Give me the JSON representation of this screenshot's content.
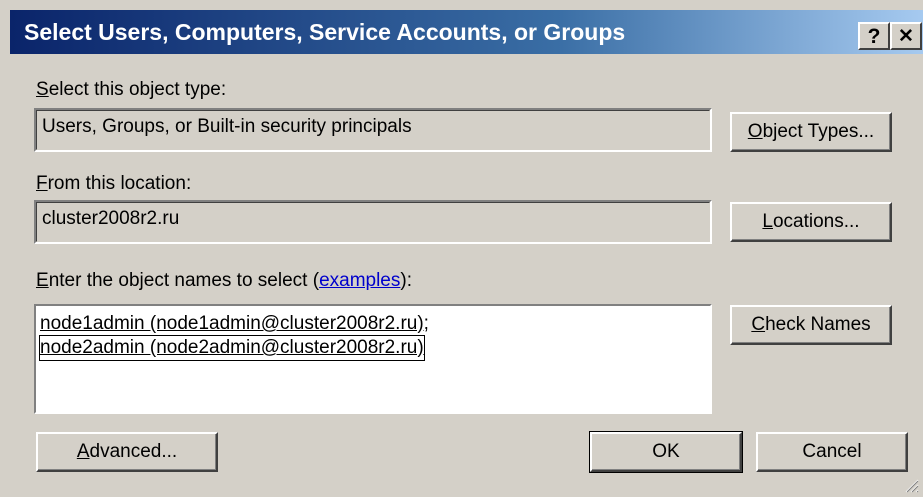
{
  "window": {
    "title": "Select Users, Computers, Service Accounts, or Groups",
    "help_glyph": "?",
    "close_glyph": "✕"
  },
  "object_type": {
    "label_key": "S",
    "label_rest": "elect this object type:",
    "value": "Users, Groups, or Built-in security principals",
    "button_key": "O",
    "button_rest": "bject Types..."
  },
  "location": {
    "label_key": "F",
    "label_rest": "rom this location:",
    "value": "cluster2008r2.ru",
    "button_key": "L",
    "button_rest": "ocations..."
  },
  "names": {
    "label_key": "E",
    "label_rest": "nter the object names to select (",
    "link": "examples",
    "label_end": "):",
    "entries": [
      "node1admin (node1admin@cluster2008r2.ru);",
      "node2admin (node2admin@cluster2008r2.ru)"
    ],
    "check_key": "C",
    "check_rest": "heck Names"
  },
  "footer": {
    "advanced_key": "A",
    "advanced_rest": "dvanced...",
    "ok_label": "OK",
    "cancel_label": "Cancel"
  }
}
